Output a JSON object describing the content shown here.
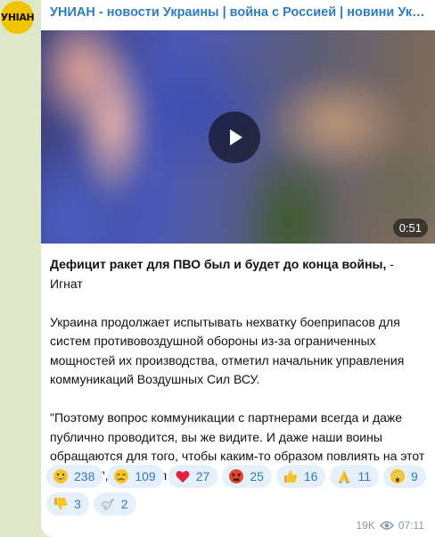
{
  "avatar": {
    "text": "УНІАН",
    "color": "#f2c300"
  },
  "channel": {
    "title": "УНИАН - новости Украины | война с Россией | новини України | война с Россией"
  },
  "video": {
    "duration": "0:51",
    "play_icon": "play-icon"
  },
  "post": {
    "headline_bold": "Дефицит ракет для ПВО был и будет до конца войны,",
    "headline_rest": " - Игнат",
    "paragraph1": "Украина продолжает испытывать нехватку боеприпасов для систем противовоздушной обороны из-за ограниченных мощностей их производства, отметил начальник управления коммуникаций Воздушных Сил ВСУ.",
    "paragraph2": "\"Поэтому вопрос коммуникации с партнерами всегда и даже публично проводится, вы же видите. И даже наши воины обращаются для того, чтобы каким-то образом повлиять на этот процесс.\", - отметил он."
  },
  "reactions": [
    {
      "icon": "grinning-face-icon",
      "count": "238"
    },
    {
      "icon": "crying-face-icon",
      "count": "109"
    },
    {
      "icon": "red-heart-icon",
      "count": "27"
    },
    {
      "icon": "angry-face-icon",
      "count": "25"
    },
    {
      "icon": "thumbs-up-icon",
      "count": "16"
    },
    {
      "icon": "folded-hands-icon",
      "count": "11"
    },
    {
      "icon": "screaming-face-icon",
      "count": "9"
    },
    {
      "icon": "thumbs-down-icon",
      "count": "3"
    },
    {
      "icon": "dove-icon",
      "count": "2"
    }
  ],
  "meta": {
    "views": "19K",
    "time": "07:11",
    "views_icon": "eye-icon"
  },
  "colors": {
    "accent": "#2f7bbd",
    "reaction_bg": "#e6f0fa",
    "chat_bg": "#dfe8c8"
  }
}
